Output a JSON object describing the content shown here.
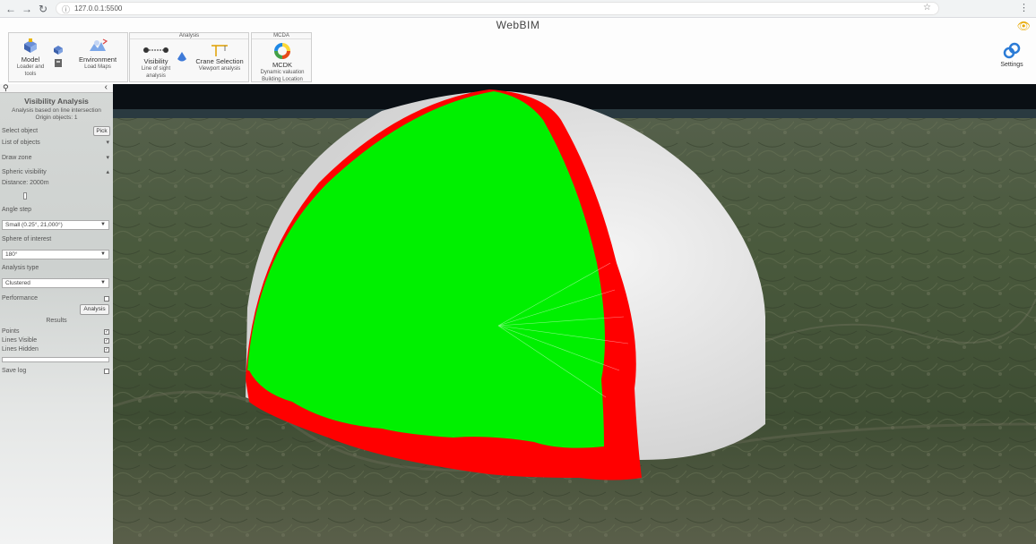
{
  "browser": {
    "url": "127.0.0.1:5500",
    "nav_icons": [
      "back-icon",
      "forward-icon",
      "reload-icon"
    ]
  },
  "app": {
    "title": "WebBIM"
  },
  "ribbon": {
    "groups": [
      {
        "label": ""
      },
      {
        "label": "Analysis"
      },
      {
        "label": "MCDA"
      }
    ],
    "model": {
      "label": "Model",
      "sub": "Loader and tools"
    },
    "environment": {
      "label": "Environment",
      "sub": "Load Maps"
    },
    "visibility": {
      "label": "Visibility",
      "sub": "Line of sight analysis"
    },
    "crane": {
      "label": "Crane Selection",
      "sub": "Viewport analysis"
    },
    "mcdk": {
      "label": "MCDK",
      "sub": "Dynamic valuation Building Location"
    },
    "settings": {
      "label": "Settings"
    }
  },
  "panel": {
    "title": "Visibility Analysis",
    "subtitle": "Analysis based on line intersection",
    "origin": "Origin objects: 1",
    "select_object": "Select object",
    "pick_label": "Pick",
    "list_of_objects": "List of objects",
    "draw_zone": "Draw zone",
    "spheric_visibility": "Spheric visibility",
    "distance": "Distance: 2000m",
    "angle_step": "Angle step",
    "angle_value": "Small (0.25°, 21,000°)",
    "sphere_interest": "Sphere of interest",
    "sphere_value": "180°",
    "analysis_type": "Analysis type",
    "analysis_value": "Clustered",
    "performance": "Performance",
    "analysis_button": "Analysis",
    "results": "Results",
    "points": "Points",
    "lines_visible": "Lines Visible",
    "lines_hidden": "Lines Hidden",
    "save_log": "Save log"
  },
  "colors": {
    "visible": "#00f000",
    "hidden": "#ff0000",
    "outside": "#e6e6e6",
    "accent": "#2b7bd6"
  }
}
